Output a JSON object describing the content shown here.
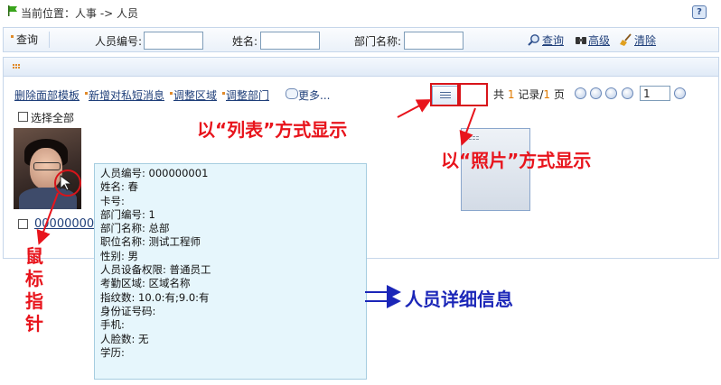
{
  "breadcrumb": {
    "text": "当前位置：人事  -> 人员"
  },
  "search": {
    "tab_label": "查询",
    "fields": [
      {
        "label": "人员编号:",
        "value": ""
      },
      {
        "label": "姓名:",
        "value": ""
      },
      {
        "label": "部门名称:",
        "value": ""
      }
    ],
    "query_label": "查询",
    "advanced_label": "高级",
    "clear_label": "清除"
  },
  "toolbar": {
    "actions": [
      "删除面部模板",
      "新增对私短消息",
      "调整区域",
      "调整部门"
    ],
    "more_label": "更多..."
  },
  "pager": {
    "prefix": "共",
    "record_count": "1",
    "records_label": "记录/",
    "page_count": "1",
    "page_label": "页",
    "current_page": "1"
  },
  "select_all_label": "选择全部",
  "person": {
    "id_display": "00000000"
  },
  "detail": {
    "rows": [
      "人员编号: 000000001",
      "姓名: 春",
      "卡号:",
      "部门编号: 1",
      "部门名称: 总部",
      "职位名称: 测试工程师",
      "性别: 男",
      "人员设备权限: 普通员工",
      "考勤区域: 区域名称",
      "指纹数: 10.0:有;9.0:有",
      "身份证号码:",
      "手机:",
      "人脸数: 无",
      "学历:"
    ]
  },
  "annotations": {
    "list_view": "以“列表”方式显示",
    "photo_view": "以“照片”方式显示",
    "mouse_pointer": "鼠标指针",
    "detail_info": "人员详细信息"
  },
  "colors": {
    "annotation_red": "#e8141c",
    "annotation_blue": "#1b26b8",
    "link": "#1f3f7a"
  }
}
